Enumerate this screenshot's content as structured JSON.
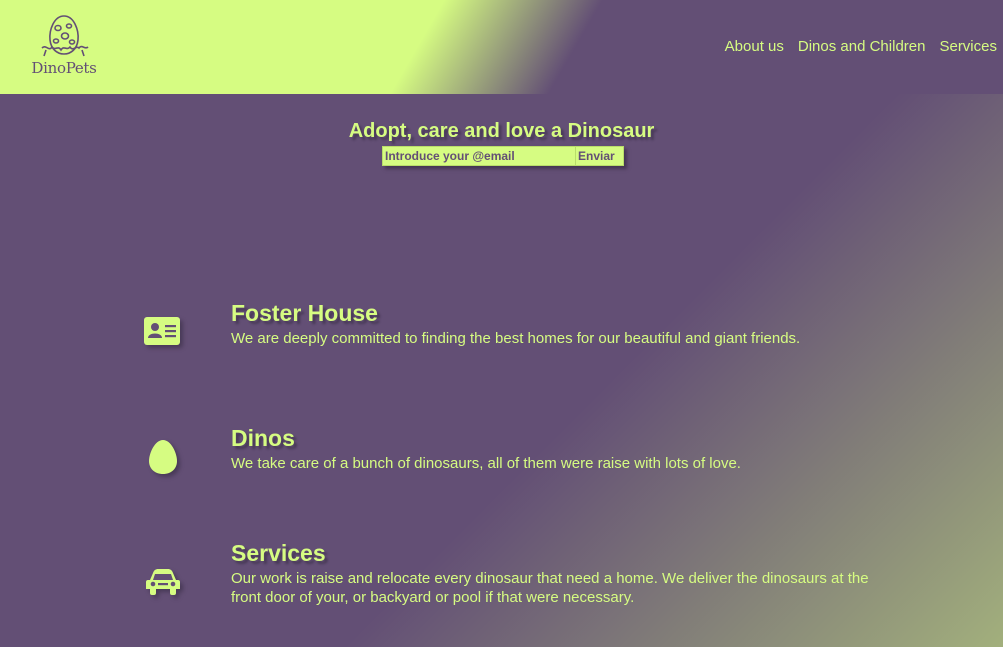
{
  "brand": {
    "name": "DinoPets",
    "logo_icon": "dino-egg-icon"
  },
  "nav": {
    "items": [
      "About us",
      "Dinos and Children",
      "Services"
    ]
  },
  "hero": {
    "title": "Adopt, care and love a Dinosaur",
    "email_placeholder": "Introduce your @email",
    "submit_label": "Enviar"
  },
  "features": [
    {
      "icon": "id-card-icon",
      "title": "Foster House",
      "text": "We are deeply committed to finding the best homes for our beautiful and giant friends."
    },
    {
      "icon": "egg-icon",
      "title": "Dinos",
      "text": "We take care of a bunch of dinosaurs, all of them were raise with lots of love."
    },
    {
      "icon": "car-icon",
      "title": "Services",
      "text": "Our work is raise and relocate every dinosaur that need a home. We deliver the dinosaurs at the front door of your, or backyard or pool if that were necessary."
    }
  ],
  "colors": {
    "primary": "#634f75",
    "accent": "#d6fc82"
  }
}
